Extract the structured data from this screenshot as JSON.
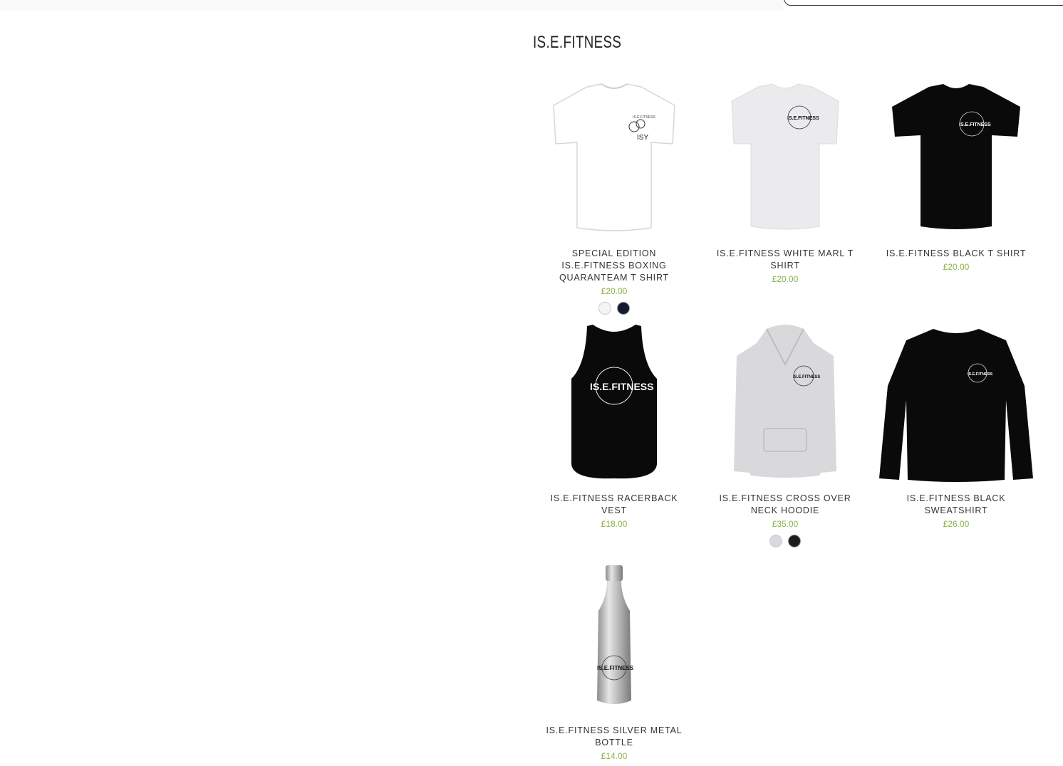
{
  "page": {
    "title": "IS.E.FITNESS"
  },
  "colors": {
    "price": "#8ab34a",
    "text": "#333333"
  },
  "products": [
    {
      "name": "SPECIAL EDITION IS.E.FITNESS BOXING QUARANTEAM T SHIRT",
      "price": "£20.00",
      "image": "white-tshirt-boxing-gloves",
      "swatches": [
        "#f2f2f2",
        "#141a2e"
      ]
    },
    {
      "name": "IS.E.FITNESS WHITE MARL T SHIRT",
      "price": "£20.00",
      "image": "white-marl-tshirt",
      "swatches": []
    },
    {
      "name": "IS.E.FITNESS BLACK T SHIRT",
      "price": "£20.00",
      "image": "black-tshirt",
      "swatches": []
    },
    {
      "name": "IS.E.FITNESS RACERBACK VEST",
      "price": "£18.00",
      "image": "black-vest",
      "swatches": []
    },
    {
      "name": "IS.E.FITNESS CROSS OVER NECK HOODIE",
      "price": "£35.00",
      "image": "grey-hoodie",
      "swatches": [
        "#d8d9de",
        "#1c1c1e"
      ]
    },
    {
      "name": "IS.E.FITNESS BLACK SWEATSHIRT",
      "price": "£26.00",
      "image": "black-sweatshirt",
      "swatches": []
    },
    {
      "name": "IS.E.FITNESS SILVER METAL BOTTLE",
      "price": "£14.00",
      "image": "silver-bottle",
      "swatches": []
    }
  ],
  "logo": {
    "brand": "IS.E.FITNESS",
    "isy": "ISY"
  }
}
